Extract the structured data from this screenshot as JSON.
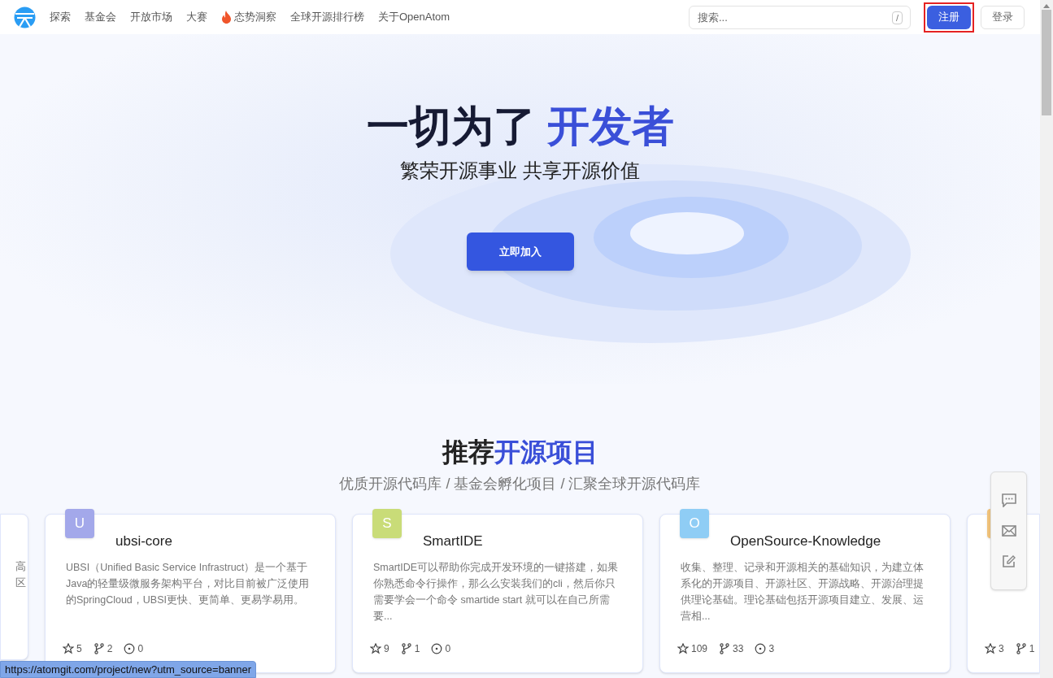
{
  "nav": {
    "items": [
      {
        "label": "探索",
        "kind": "link"
      },
      {
        "label": "基金会",
        "kind": "link"
      },
      {
        "label": "开放市场",
        "kind": "link"
      },
      {
        "label": "大赛",
        "kind": "link"
      },
      {
        "label": "态势洞察",
        "kind": "hot"
      },
      {
        "label": "全球开源排行榜",
        "kind": "link"
      },
      {
        "label": "关于OpenAtom",
        "kind": "link"
      }
    ],
    "search": {
      "placeholder": "搜索...",
      "shortcut": "/"
    },
    "register": {
      "label": "注册",
      "highlighted": true
    },
    "login": {
      "label": "登录"
    }
  },
  "hero": {
    "title": "一切为了",
    "title_accent": "开发者",
    "subtitle": "繁荣开源事业 共享开源价值",
    "button": "立即加入"
  },
  "section": {
    "title": "推荐",
    "title_accent": "开源项目",
    "subtitle": "优质开源代码库 / 基金会孵化项目 / 汇聚全球开源代码库"
  },
  "cards": [
    {
      "kind": "edge-left",
      "description_lines": [
        "高",
        "区"
      ]
    },
    {
      "kind": "full",
      "letter": "U",
      "color": "#a3a8ea",
      "name": "ubsi-core",
      "description": "UBSI（Unified Basic Service Infrastruct）是一个基于Java的轻量级微服务架构平台，对比目前被广泛使用的SpringCloud，UBSI更快、更简单、更易学易用。",
      "stars": "5",
      "forks": "2",
      "issues": "0"
    },
    {
      "kind": "full",
      "letter": "S",
      "color": "#c9dc78",
      "name": "SmartIDE",
      "description": "SmartIDE可以帮助你完成开发环境的一键搭建，如果你熟悉命令行操作，那么么安装我们的cli，然后你只需要学会一个命令 smartide start 就可以在自己所需要...",
      "stars": "9",
      "forks": "1",
      "issues": "0"
    },
    {
      "kind": "full",
      "letter": "O",
      "color": "#8fcdf5",
      "name": "OpenSource-Knowledge",
      "description": "收集、整理、记录和开源相关的基础知识，为建立体系化的开源项目、开源社区、开源战略、开源治理提供理论基础。理论基础包括开源项目建立、发展、运营相...",
      "stars": "109",
      "forks": "33",
      "issues": "3"
    },
    {
      "kind": "edge-right",
      "color": "#f0c27a",
      "stars": "3",
      "forks": "1"
    }
  ],
  "status_url": "https://atomgit.com/project/new?utm_source=banner"
}
